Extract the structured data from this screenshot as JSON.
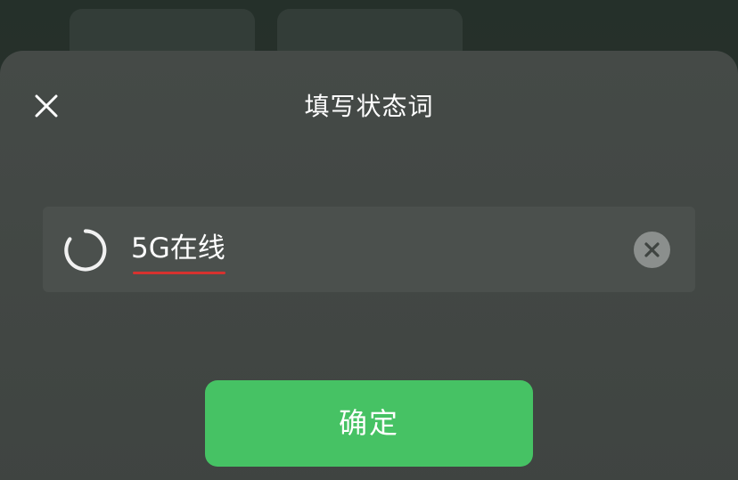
{
  "dialog": {
    "title": "填写状态词",
    "close_icon": "close-icon",
    "status_icon": "status-ring-icon",
    "input_value": "5G在线",
    "clear_icon": "clear-circle-icon",
    "confirm_label": "确定"
  },
  "colors": {
    "confirm_green": "#46c264",
    "underline_red": "#d7322f",
    "sheet_bg": "#454a47"
  }
}
